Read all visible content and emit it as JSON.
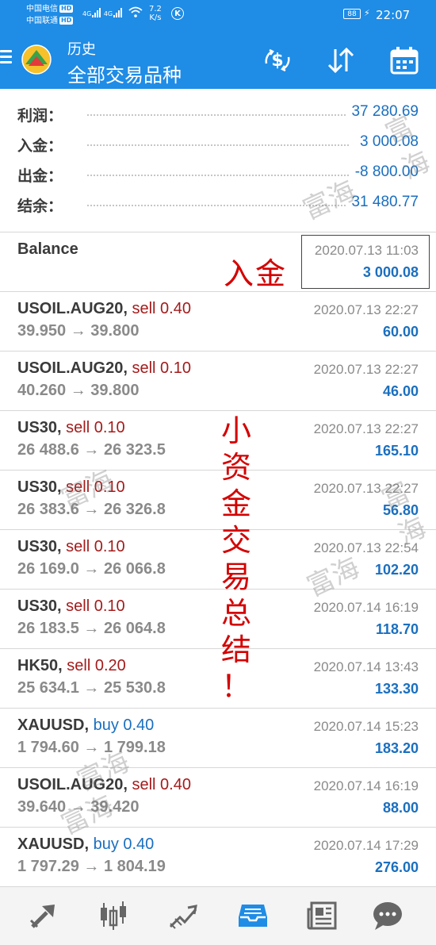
{
  "status_bar": {
    "carrier1": "中国电信",
    "carrier2": "中国联通",
    "hd": "HD",
    "net": "4G",
    "speed_value": "7.2",
    "speed_unit": "K/s",
    "k_badge": "K",
    "battery": "88",
    "time": "22:07"
  },
  "header": {
    "title": "历史",
    "subtitle": "全部交易品种",
    "icons": [
      "menu-icon",
      "app-logo-icon",
      "dollar-exchange-icon",
      "sort-icon",
      "calendar-icon"
    ]
  },
  "summary": [
    {
      "label": "利润：",
      "value": "37 280.69"
    },
    {
      "label": "入金：",
      "value": "3 000.08"
    },
    {
      "label": "出金：",
      "value": "-8 800.00"
    },
    {
      "label": "结余：",
      "value": "31 480.77"
    }
  ],
  "balance": {
    "label": "Balance",
    "time": "2020.07.13 11:03",
    "amount": "3 000.08"
  },
  "deals": [
    {
      "symbol": "USOIL.AUG20,",
      "side": "sell 0.40",
      "type": "sell",
      "price": "39.950 → 39.800",
      "time": "2020.07.13 22:27",
      "profit": "60.00"
    },
    {
      "symbol": "USOIL.AUG20,",
      "side": "sell 0.10",
      "type": "sell",
      "price": "40.260 → 39.800",
      "time": "2020.07.13 22:27",
      "profit": "46.00"
    },
    {
      "symbol": "US30,",
      "side": "sell 0.10",
      "type": "sell",
      "price": "26 488.6 → 26 323.5",
      "time": "2020.07.13 22:27",
      "profit": "165.10"
    },
    {
      "symbol": "US30,",
      "side": "sell 0.10",
      "type": "sell",
      "price": "26 383.6 → 26 326.8",
      "time": "2020.07.13 22:27",
      "profit": "56.80"
    },
    {
      "symbol": "US30,",
      "side": "sell 0.10",
      "type": "sell",
      "price": "26 169.0 → 26 066.8",
      "time": "2020.07.13 22:54",
      "profit": "102.20"
    },
    {
      "symbol": "US30,",
      "side": "sell 0.10",
      "type": "sell",
      "price": "26 183.5 → 26 064.8",
      "time": "2020.07.14 16:19",
      "profit": "118.70"
    },
    {
      "symbol": "HK50,",
      "side": "sell 0.20",
      "type": "sell",
      "price": "25 634.1 → 25 530.8",
      "time": "2020.07.14 13:43",
      "profit": "133.30"
    },
    {
      "symbol": "XAUUSD,",
      "side": "buy 0.40",
      "type": "buy",
      "price": "1 794.60 → 1 799.18",
      "time": "2020.07.14 15:23",
      "profit": "183.20"
    },
    {
      "symbol": "USOIL.AUG20,",
      "side": "sell 0.40",
      "type": "sell",
      "price": "39.640 → 39.420",
      "time": "2020.07.14 16:19",
      "profit": "88.00"
    },
    {
      "symbol": "XAUUSD,",
      "side": "buy 0.40",
      "type": "buy",
      "price": "1 797.29 → 1 804.19",
      "time": "2020.07.14 17:29",
      "profit": "276.00"
    }
  ],
  "overlay": {
    "deposit_note": "入金",
    "summary_note": [
      "小",
      "资",
      "金",
      "交",
      "易",
      "总",
      "结",
      "！"
    ]
  },
  "watermark_text": "富海",
  "bottom_nav": [
    {
      "name": "quotes",
      "icon": "quotes-arrow-icon"
    },
    {
      "name": "chart",
      "icon": "candlestick-icon"
    },
    {
      "name": "trade",
      "icon": "trend-line-icon"
    },
    {
      "name": "history",
      "icon": "inbox-tray-icon",
      "active": true
    },
    {
      "name": "news",
      "icon": "newspaper-icon"
    },
    {
      "name": "chat",
      "icon": "chat-bubble-icon"
    }
  ],
  "colors": {
    "primary": "#1f8ce6",
    "profit_blue": "#1a6fbf",
    "sell_red": "#a41b1b",
    "overlay_red": "#d40000",
    "muted_grey": "#8a8a8a"
  }
}
